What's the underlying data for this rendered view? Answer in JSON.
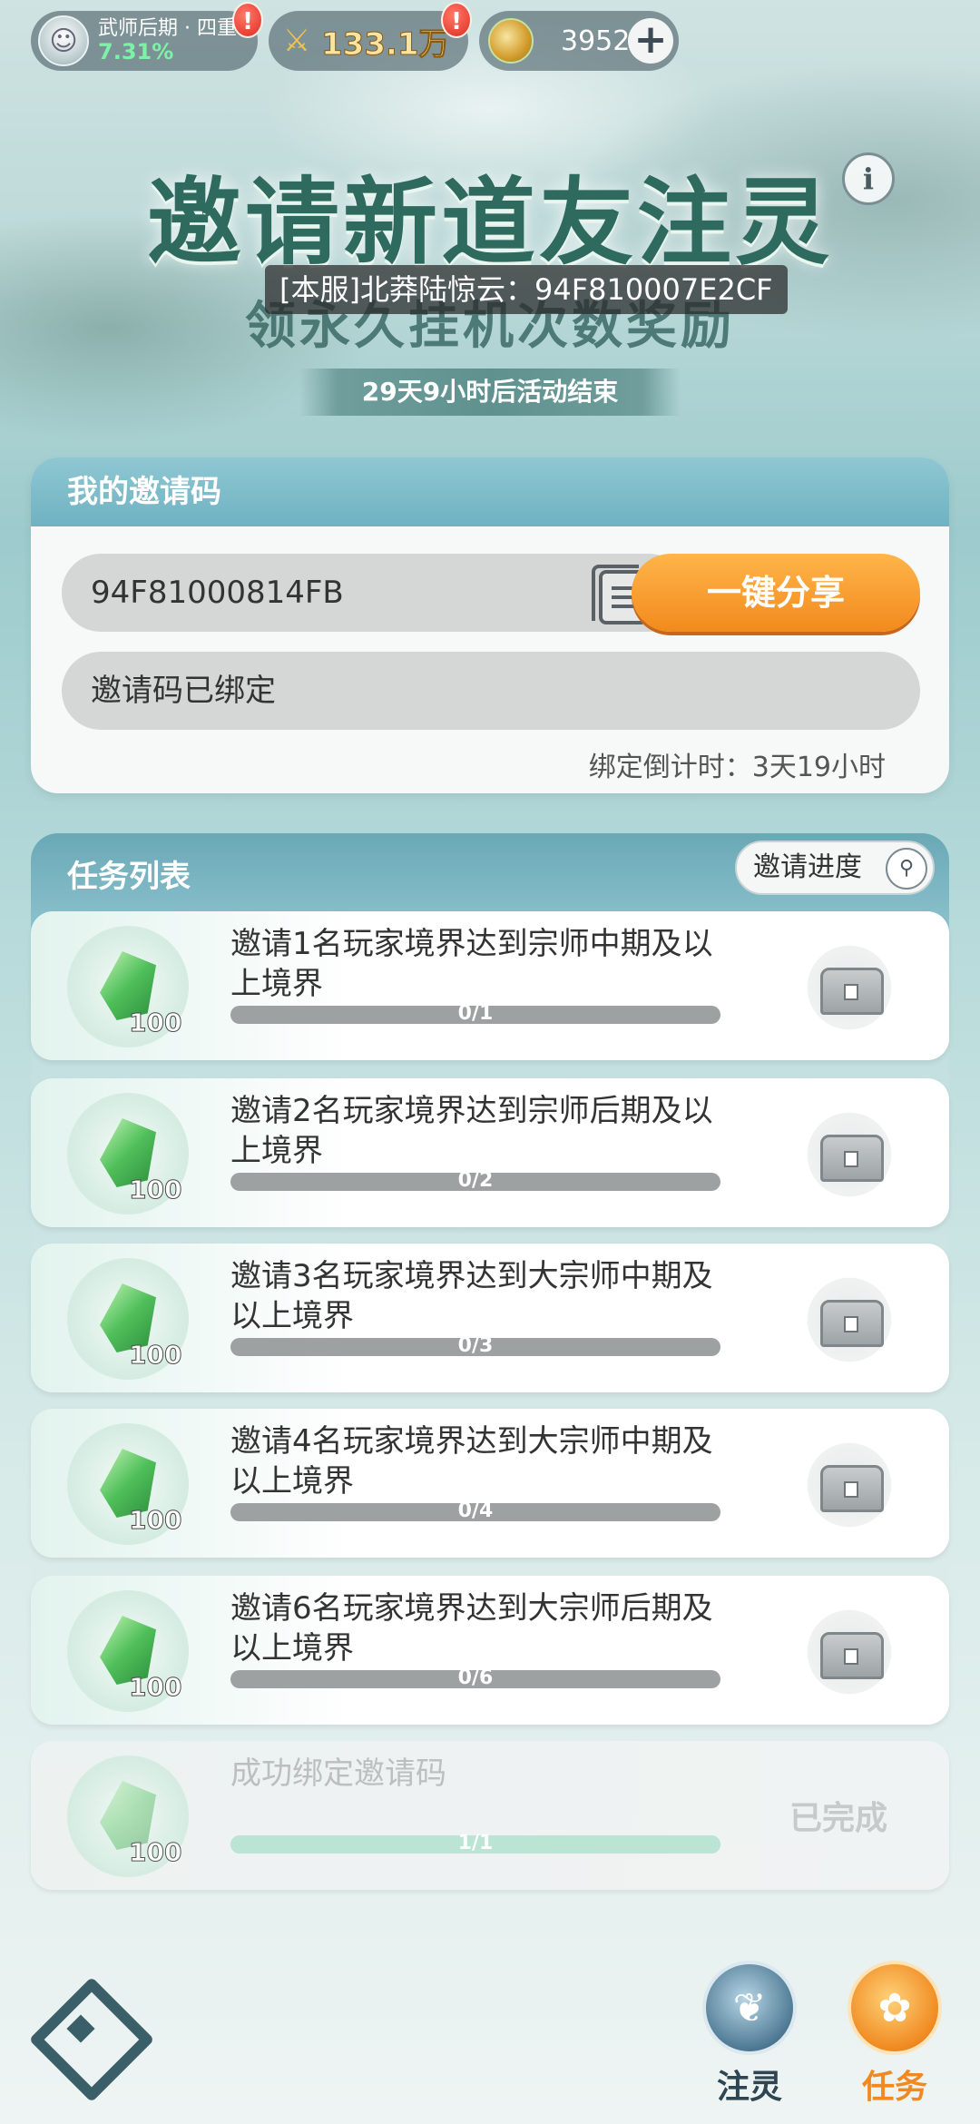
{
  "status_bar": {
    "rank_title": "武师后期 · 四重",
    "rank_percent": "7.31%",
    "rank_alert": "!",
    "power_value": "133.1万",
    "power_alert": "!",
    "coin_value": "3952",
    "plus_label": "+"
  },
  "hero": {
    "title": "邀请新道友注灵",
    "subtitle": "领永久挂机次数奖励",
    "countdown": "29天9小时后活动结束",
    "info_label": "i"
  },
  "toast": {
    "text": "[本服]北莽陆惊云：94F810007E2CF"
  },
  "invite": {
    "header": "我的邀请码",
    "code": "94F81000814FB",
    "share_label": "一键分享",
    "bound_text": "邀请码已绑定",
    "bind_countdown": "绑定倒计时：3天19小时"
  },
  "tasks": {
    "header": "任务列表",
    "progress_button": "邀请进度",
    "items": [
      {
        "desc": "邀请1名玩家境界达到宗师中期及以上境界",
        "reward": "100",
        "progress": "0/1",
        "fraction": 0
      },
      {
        "desc": "邀请2名玩家境界达到宗师后期及以上境界",
        "reward": "100",
        "progress": "0/2",
        "fraction": 0
      },
      {
        "desc": "邀请3名玩家境界达到大宗师中期及以上境界",
        "reward": "100",
        "progress": "0/3",
        "fraction": 0
      },
      {
        "desc": "邀请4名玩家境界达到大宗师中期及以上境界",
        "reward": "100",
        "progress": "0/4",
        "fraction": 0
      },
      {
        "desc": "邀请6名玩家境界达到大宗师后期及以上境界",
        "reward": "100",
        "progress": "0/6",
        "fraction": 0
      },
      {
        "desc": "成功绑定邀请码",
        "reward": "100",
        "progress": "1/1",
        "fraction": 1,
        "status": "已完成"
      }
    ]
  },
  "nav": {
    "zhuling_label": "注灵",
    "tasks_label": "任务"
  }
}
